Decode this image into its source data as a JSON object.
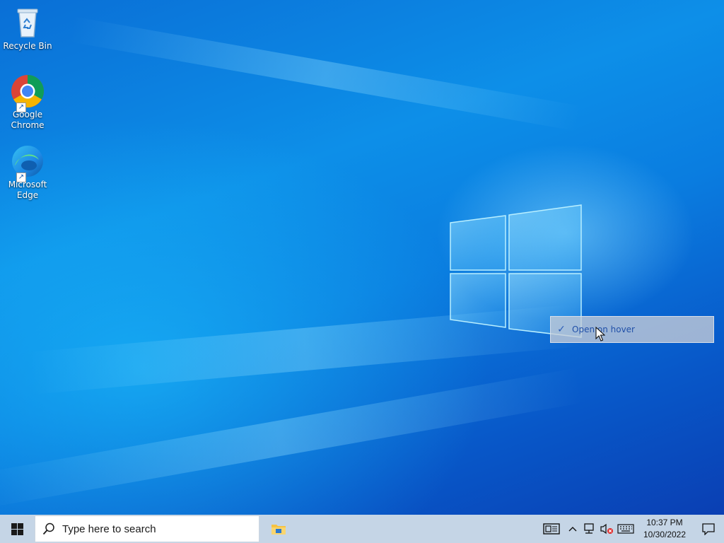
{
  "desktop": {
    "icons": [
      {
        "label": "Recycle Bin",
        "icon": "recycle-bin-icon"
      },
      {
        "label": "Google Chrome",
        "icon": "chrome-icon"
      },
      {
        "label": "Microsoft Edge",
        "icon": "edge-icon"
      }
    ],
    "context_menu": {
      "items": [
        {
          "label": "Open on hover",
          "checked": true
        }
      ]
    }
  },
  "taskbar": {
    "start_icon": "windows-logo-icon",
    "search": {
      "placeholder": "Type here to search",
      "icon": "search-icon"
    },
    "pinned": [
      {
        "icon": "file-explorer-icon"
      }
    ],
    "tray": {
      "icons": [
        "news-widget-icon",
        "chevron-up-icon",
        "network-icon",
        "volume-muted-icon",
        "keyboard-icon",
        "notification-icon"
      ],
      "time": "10:37 PM",
      "date": "10/30/2022"
    },
    "background": "#c5d5e6"
  },
  "colors": {
    "desktop_accent": "#0a7de0",
    "menu_text": "#2150a8"
  }
}
